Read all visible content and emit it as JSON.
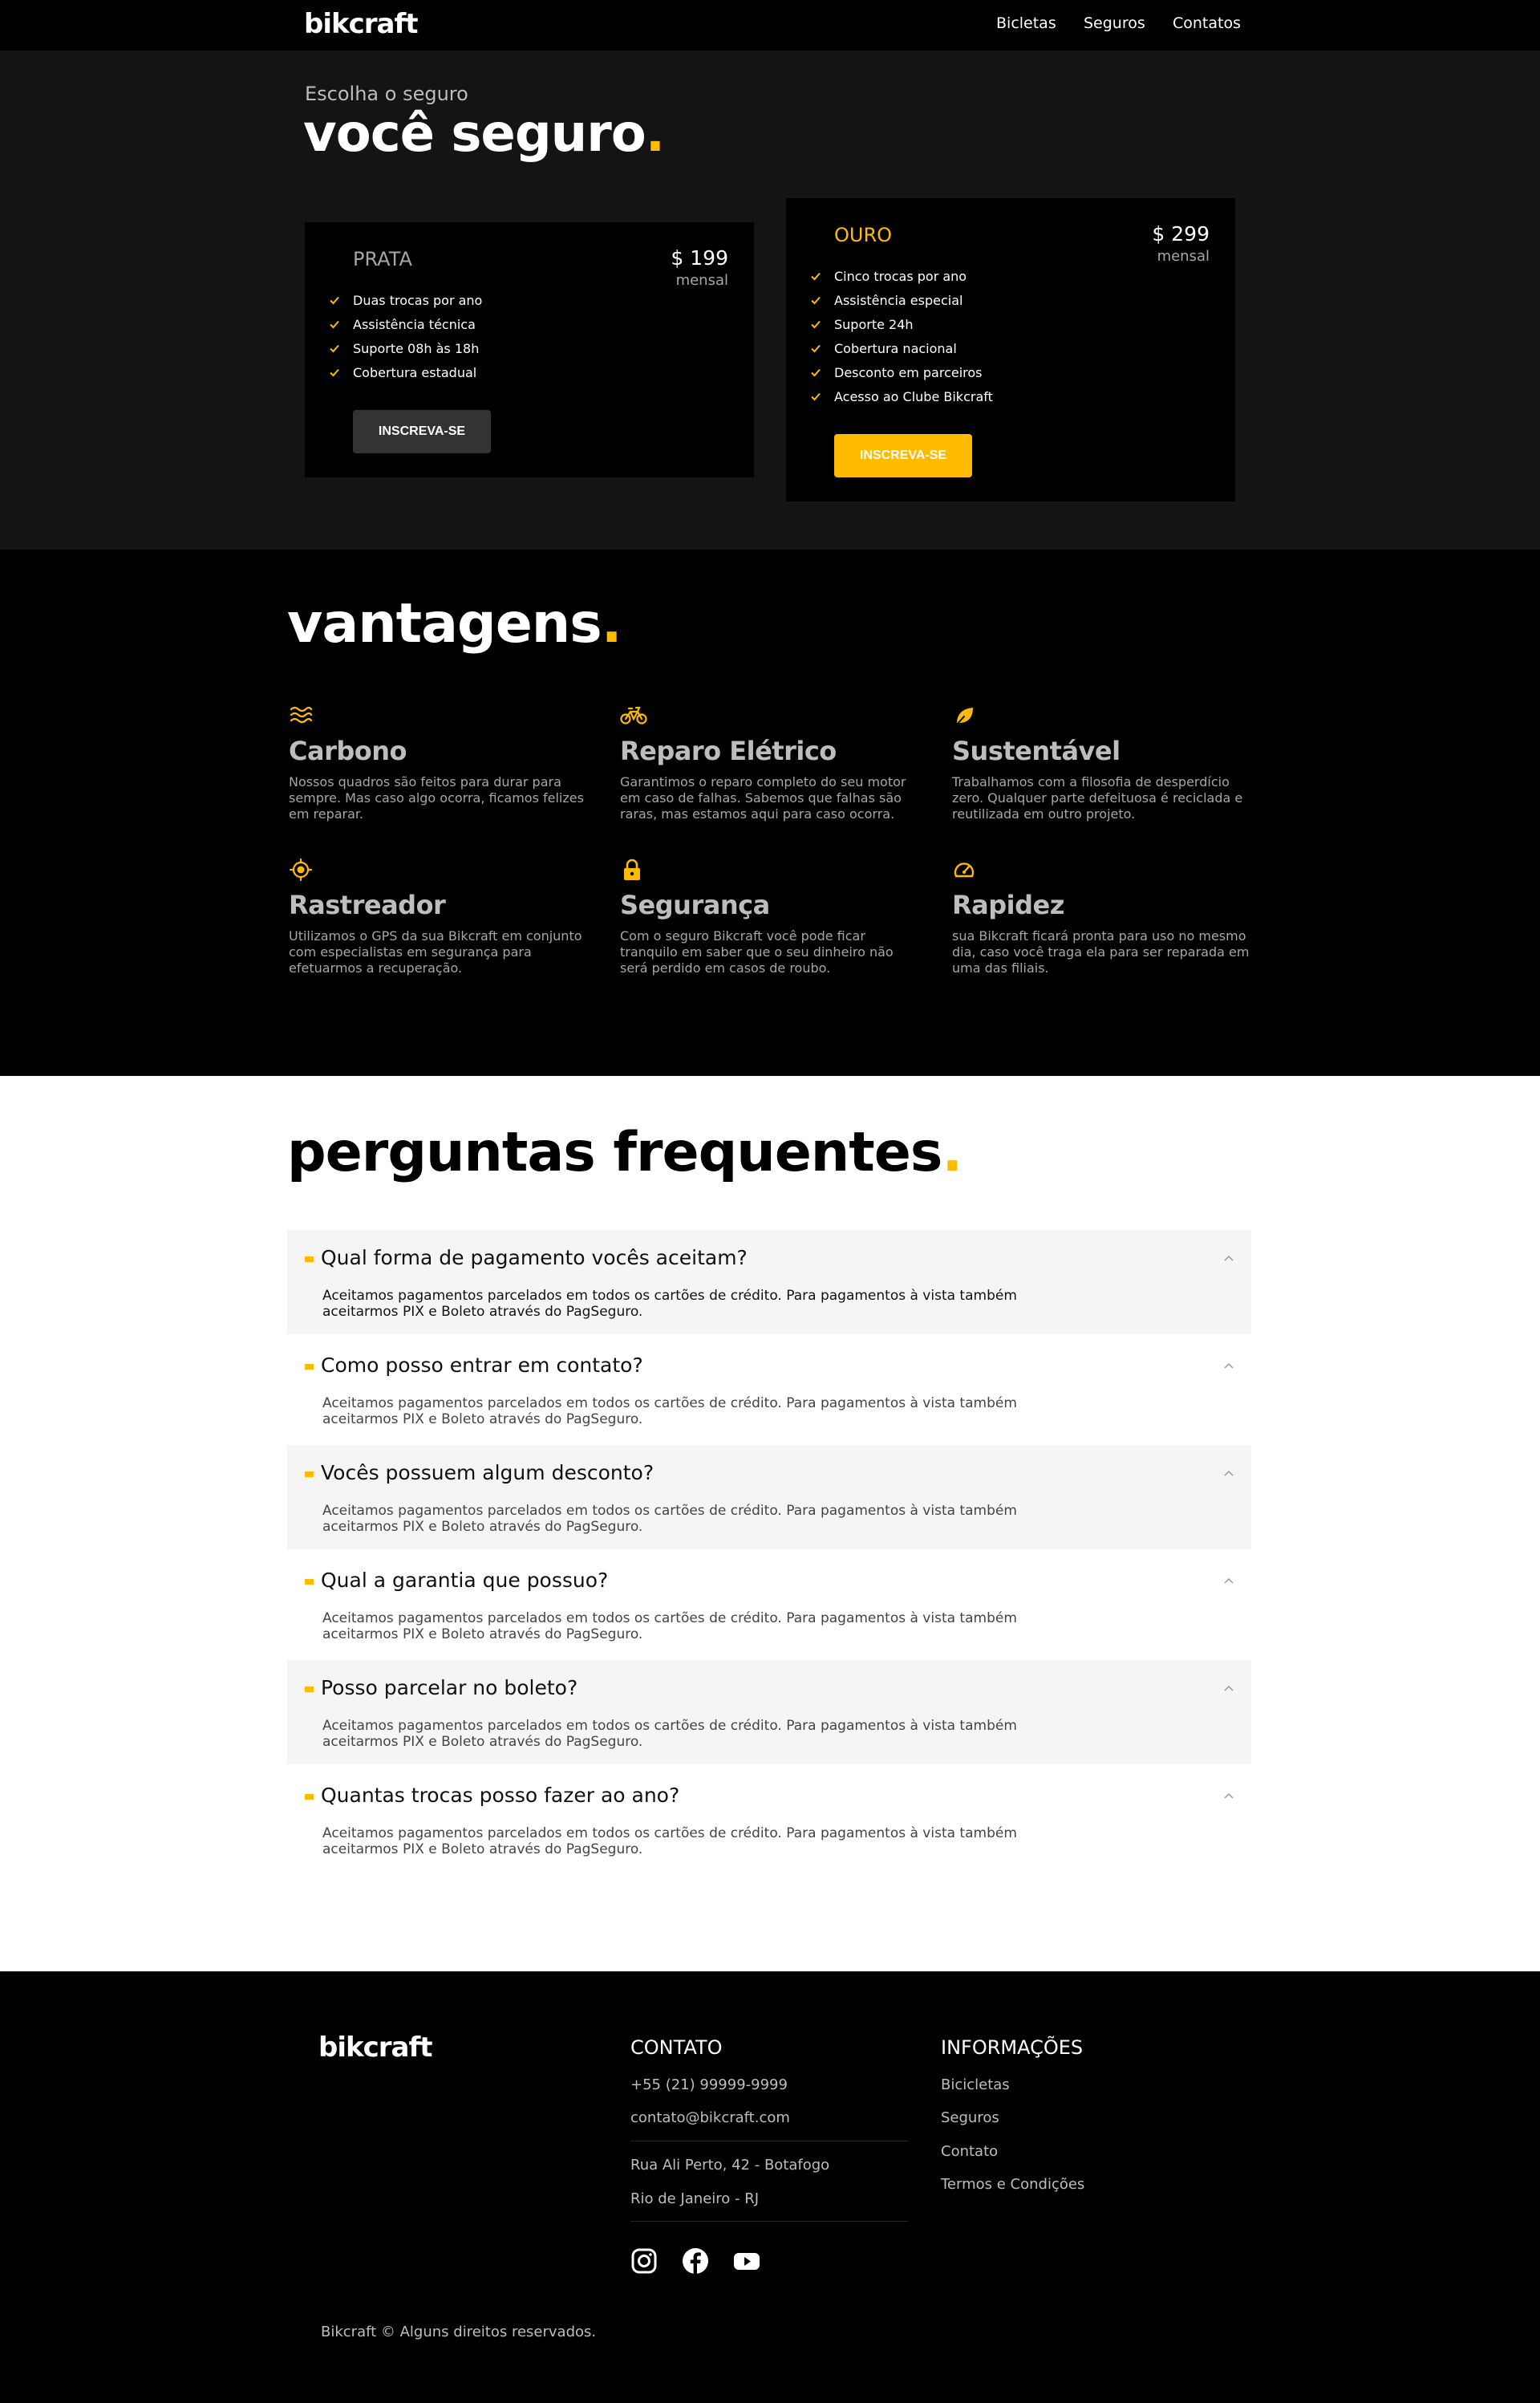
{
  "header": {
    "logo": "bikcraft",
    "nav": [
      {
        "label": "Bicletas"
      },
      {
        "label": "Seguros"
      },
      {
        "label": "Contatos"
      }
    ]
  },
  "hero": {
    "subtitle": "Escolha o seguro",
    "title": "você seguro",
    "dot": "."
  },
  "plans": [
    {
      "name": "PRATA",
      "price": "$ 199",
      "period": "mensal",
      "features": [
        "Duas trocas por ano",
        "Assistência técnica",
        "Suporte 08h às 18h",
        "Cobertura estadual"
      ],
      "button": "INSCREVA-SE"
    },
    {
      "name": "OURO",
      "price": "$ 299",
      "period": "mensal",
      "features": [
        "Cinco trocas por ano",
        "Assistência especial",
        "Suporte 24h",
        "Cobertura nacional",
        "Desconto em parceiros",
        "Acesso ao Clube Bikcraft"
      ],
      "button": "INSCREVA-SE"
    }
  ],
  "vantagens": {
    "title": "vantagens",
    "dot": ".",
    "items": [
      {
        "icon": "carbon-waves-icon",
        "title": "Carbono",
        "desc": "Nossos quadros são feitos para durar para sempre. Mas caso algo ocorra, ficamos felizes em reparar."
      },
      {
        "icon": "electric-bike-icon",
        "title": "Reparo Elétrico",
        "desc": "Garantimos o reparo completo do seu motor em caso de falhas. Sabemos que falhas são raras, mas estamos aqui para caso ocorra."
      },
      {
        "icon": "leaf-icon",
        "title": "Sustentável",
        "desc": "Trabalhamos com a filosofia de desperdício zero. Qualquer parte defeituosa é reciclada e reutilizada em outro projeto."
      },
      {
        "icon": "target-icon",
        "title": "Rastreador",
        "desc": "Utilizamos o GPS da sua Bikcraft em conjunto com especialistas em segurança para efetuarmos a recuperação."
      },
      {
        "icon": "lock-icon",
        "title": "Segurança",
        "desc": "Com o seguro Bikcraft você pode ficar tranquilo em saber que o seu dinheiro não será perdido em casos de roubo."
      },
      {
        "icon": "speedometer-icon",
        "title": "Rapidez",
        "desc": "sua Bikcraft ficará pronta para uso no mesmo dia, caso você traga ela para ser reparada em uma das filiais."
      }
    ]
  },
  "faq": {
    "title": "perguntas frequentes",
    "dot": ".",
    "items": [
      {
        "q": "Qual forma de pagamento vocês aceitam?",
        "a": "Aceitamos pagamentos parcelados em todos os cartões de crédito. Para pagamentos à vista também aceitarmos PIX e Boleto através do PagSeguro."
      },
      {
        "q": "Como posso entrar em contato?",
        "a": "Aceitamos pagamentos parcelados em todos os cartões de crédito. Para pagamentos à vista também aceitarmos PIX e Boleto através do PagSeguro."
      },
      {
        "q": "Vocês possuem algum desconto?",
        "a": "Aceitamos pagamentos parcelados em todos os cartões de crédito. Para pagamentos à vista também aceitarmos PIX e Boleto através do PagSeguro."
      },
      {
        "q": "Qual a garantia que possuo?",
        "a": "Aceitamos pagamentos parcelados em todos os cartões de crédito. Para pagamentos à vista também aceitarmos PIX e Boleto através do PagSeguro."
      },
      {
        "q": "Posso parcelar no boleto?",
        "a": "Aceitamos pagamentos parcelados em todos os cartões de crédito. Para pagamentos à vista também aceitarmos PIX e Boleto através do PagSeguro."
      },
      {
        "q": "Quantas trocas posso fazer ao ano?",
        "a": "Aceitamos pagamentos parcelados em todos os cartões de crédito. Para pagamentos à vista também aceitarmos PIX e Boleto através do PagSeguro."
      }
    ]
  },
  "footer": {
    "logo": "bikcraft",
    "contact": {
      "title": "CONTATO",
      "phone": "+55 (21) 99999-9999",
      "email": "contato@bikcraft.com",
      "address1": "Rua Ali Perto, 42 - Botafogo",
      "address2": "Rio de Janeiro - RJ"
    },
    "info": {
      "title": "INFORMAÇÕES",
      "links": [
        "Bicicletas",
        "Seguros",
        "Contato",
        "Termos e Condições"
      ]
    },
    "social": [
      "instagram-icon",
      "facebook-icon",
      "youtube-icon"
    ],
    "copyright": "Bikcraft © Alguns direitos reservados."
  },
  "colors": {
    "accent": "#ffbb00",
    "dark": "#000000",
    "panel": "#141414",
    "muted": "#a6a6a6"
  }
}
